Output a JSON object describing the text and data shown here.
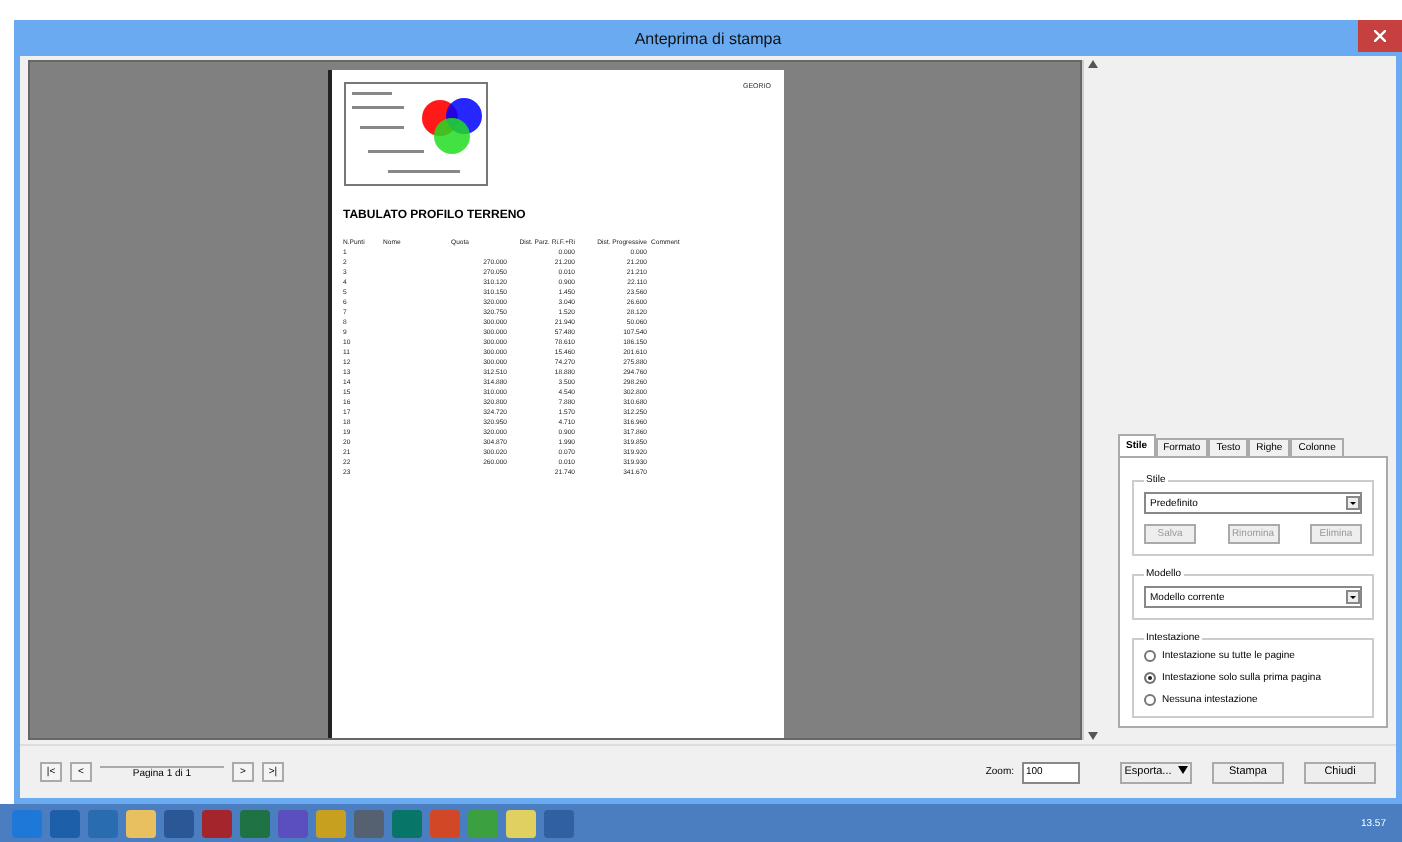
{
  "window": {
    "title": "Anteprima di stampa"
  },
  "document": {
    "header_right": "GEORIO",
    "title": "TABULATO PROFILO TERRENO",
    "columns": [
      "N.Punti",
      "Nome",
      "Quota",
      "Dist. Parz. Ri.F.+Ri",
      "Dist. Progressive",
      "Comment"
    ],
    "rows": [
      [
        "1",
        "",
        "",
        "0.000",
        "0.000"
      ],
      [
        "2",
        "",
        "270.000",
        "21.200",
        "21.200"
      ],
      [
        "3",
        "",
        "270.050",
        "0.010",
        "21.210"
      ],
      [
        "4",
        "",
        "310.120",
        "0.900",
        "22.110"
      ],
      [
        "5",
        "",
        "310.150",
        "1.450",
        "23.560"
      ],
      [
        "6",
        "",
        "320.000",
        "3.040",
        "26.600"
      ],
      [
        "7",
        "",
        "320.750",
        "1.520",
        "28.120"
      ],
      [
        "8",
        "",
        "300.000",
        "21.940",
        "50.060"
      ],
      [
        "9",
        "",
        "300.000",
        "57.480",
        "107.540"
      ],
      [
        "10",
        "",
        "300.000",
        "78.610",
        "186.150"
      ],
      [
        "11",
        "",
        "300.000",
        "15.460",
        "201.610"
      ],
      [
        "12",
        "",
        "300.000",
        "74.270",
        "275.880"
      ],
      [
        "13",
        "",
        "312.510",
        "18.880",
        "294.760"
      ],
      [
        "14",
        "",
        "314.880",
        "3.500",
        "298.260"
      ],
      [
        "15",
        "",
        "310.000",
        "4.540",
        "302.800"
      ],
      [
        "16",
        "",
        "320.800",
        "7.880",
        "310.680"
      ],
      [
        "17",
        "",
        "324.720",
        "1.570",
        "312.250"
      ],
      [
        "18",
        "",
        "320.950",
        "4.710",
        "316.960"
      ],
      [
        "19",
        "",
        "320.000",
        "0.900",
        "317.860"
      ],
      [
        "20",
        "",
        "304.870",
        "1.990",
        "319.850"
      ],
      [
        "21",
        "",
        "300.020",
        "0.070",
        "319.920"
      ],
      [
        "22",
        "",
        "260.000",
        "0.010",
        "319.930"
      ],
      [
        "23",
        "",
        "",
        "21.740",
        "341.670"
      ]
    ]
  },
  "panel": {
    "tabs": [
      {
        "label": "Stile",
        "selected": true
      },
      {
        "label": "Formato",
        "selected": false
      },
      {
        "label": "Testo",
        "selected": false
      },
      {
        "label": "Righe",
        "selected": false
      },
      {
        "label": "Colonne",
        "selected": false
      }
    ],
    "style_group": {
      "legend": "Stile",
      "value": "Predefinito",
      "buttons": [
        {
          "label": "Salva",
          "disabled": true
        },
        {
          "label": "Rinomina",
          "disabled": true
        },
        {
          "label": "Elimina",
          "disabled": true
        }
      ]
    },
    "model_group": {
      "legend": "Modello",
      "value": "Modello corrente"
    },
    "header_group": {
      "legend": "Intestazione",
      "options": [
        {
          "label": "Intestazione su tutte le pagine",
          "selected": false
        },
        {
          "label": "Intestazione solo sulla prima pagina",
          "selected": true
        },
        {
          "label": "Nessuna intestazione",
          "selected": false
        }
      ]
    }
  },
  "footer": {
    "page_label": "Pagina 1 di 1",
    "nav": [
      "|<",
      "<",
      ">",
      ">|"
    ],
    "zoom_label": "Zoom:",
    "zoom_value": "100",
    "export": "Esporta...",
    "print": "Stampa",
    "close": "Chiudi"
  },
  "taskbar": {
    "time": "13.57",
    "apps": [
      {
        "color": "#1e78d8"
      },
      {
        "color": "#1d5fa8"
      },
      {
        "color": "#2a6cb0"
      },
      {
        "color": "#e8c060"
      },
      {
        "color": "#2b5797"
      },
      {
        "color": "#a4262c"
      },
      {
        "color": "#1f7244"
      },
      {
        "color": "#5b4fbf"
      },
      {
        "color": "#c8a020"
      },
      {
        "color": "#556070"
      },
      {
        "color": "#077568"
      },
      {
        "color": "#d24726"
      },
      {
        "color": "#3aa040"
      },
      {
        "color": "#e0d060"
      },
      {
        "color": "#3060a0"
      }
    ]
  }
}
